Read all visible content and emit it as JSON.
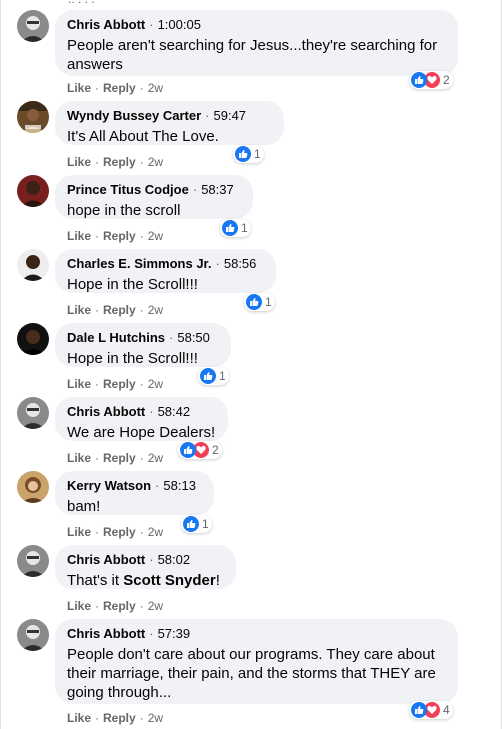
{
  "actions": {
    "like": "Like",
    "reply": "Reply"
  },
  "comments": [
    {
      "author": "Chris Abbott",
      "timestamp": "1:00:05",
      "text": "People aren't searching for Jesus...they're searching for answers",
      "age": "2w",
      "reactions": {
        "types": [
          "like",
          "love"
        ],
        "count": "2"
      }
    },
    {
      "author": "Wyndy Bussey Carter",
      "timestamp": "59:47",
      "text": "It's All About The Love.",
      "age": "2w",
      "reactions": {
        "types": [
          "like"
        ],
        "count": "1"
      }
    },
    {
      "author": "Prince Titus Codjoe",
      "timestamp": "58:37",
      "text": "hope in the scroll",
      "age": "2w",
      "reactions": {
        "types": [
          "like"
        ],
        "count": "1"
      }
    },
    {
      "author": "Charles E. Simmons Jr.",
      "timestamp": "58:56",
      "text": "Hope in the Scroll!!!",
      "age": "2w",
      "reactions": {
        "types": [
          "like"
        ],
        "count": "1"
      }
    },
    {
      "author": "Dale L Hutchins",
      "timestamp": "58:50",
      "text": "Hope in the Scroll!!!",
      "age": "2w",
      "reactions": {
        "types": [
          "like"
        ],
        "count": "1"
      }
    },
    {
      "author": "Chris Abbott",
      "timestamp": "58:42",
      "text": "We are Hope Dealers!",
      "age": "2w",
      "reactions": {
        "types": [
          "like",
          "love"
        ],
        "count": "2"
      }
    },
    {
      "author": "Kerry Watson",
      "timestamp": "58:13",
      "text": "bam!",
      "age": "2w",
      "reactions": {
        "types": [
          "like"
        ],
        "count": "1"
      }
    },
    {
      "author": "Chris Abbott",
      "timestamp": "58:02",
      "text_prefix": "That's it ",
      "mention": "Scott Snyder",
      "text_suffix": "!",
      "age": "2w"
    },
    {
      "author": "Chris Abbott",
      "timestamp": "57:39",
      "text": "People don't care about our programs. They care about their marriage, their pain, and the storms that THEY are going through...",
      "age": "2w",
      "reactions": {
        "types": [
          "like",
          "love"
        ],
        "count": "4"
      }
    }
  ]
}
